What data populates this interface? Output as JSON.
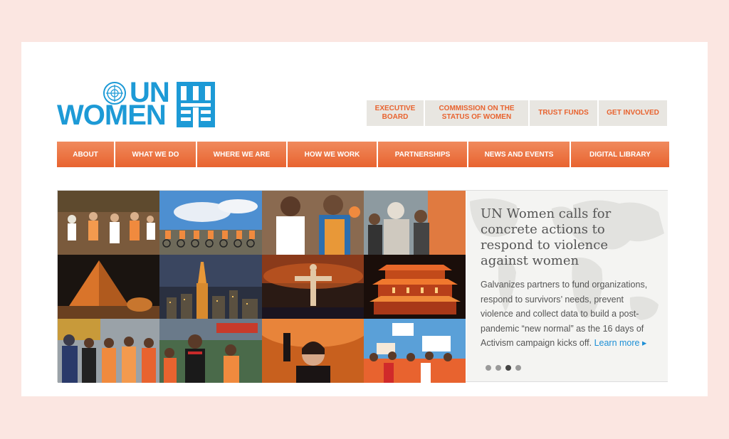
{
  "brand": {
    "name_line1": "UN",
    "name_line2": "WOMEN",
    "color": "#1d9ad6",
    "icons": [
      "un-emblem-icon",
      "un-women-symbol-icon"
    ]
  },
  "top_links": [
    {
      "label": "EXECUTIVE BOARD"
    },
    {
      "label": "COMMISSION ON THE STATUS OF WOMEN"
    },
    {
      "label": "TRUST FUNDS"
    },
    {
      "label": "GET INVOLVED"
    }
  ],
  "nav": {
    "items": [
      {
        "label": "ABOUT"
      },
      {
        "label": "WHAT WE DO"
      },
      {
        "label": "WHERE WE ARE"
      },
      {
        "label": "HOW WE WORK"
      },
      {
        "label": "PARTNERSHIPS"
      },
      {
        "label": "NEWS AND EVENTS"
      },
      {
        "label": "DIGITAL LIBRARY"
      }
    ],
    "color": "#e8632f"
  },
  "hero": {
    "title": "UN Women calls for concrete actions to respond to violence against women",
    "body": "Galvanizes partners to fund organizations, respond to survivors’ needs, prevent violence and collect data to build a post-pandemic “new normal” as the 16 days of Activism campaign kicks off.",
    "learn_more": "Learn more ▸",
    "slides_total": 4,
    "slides_active": 3
  }
}
